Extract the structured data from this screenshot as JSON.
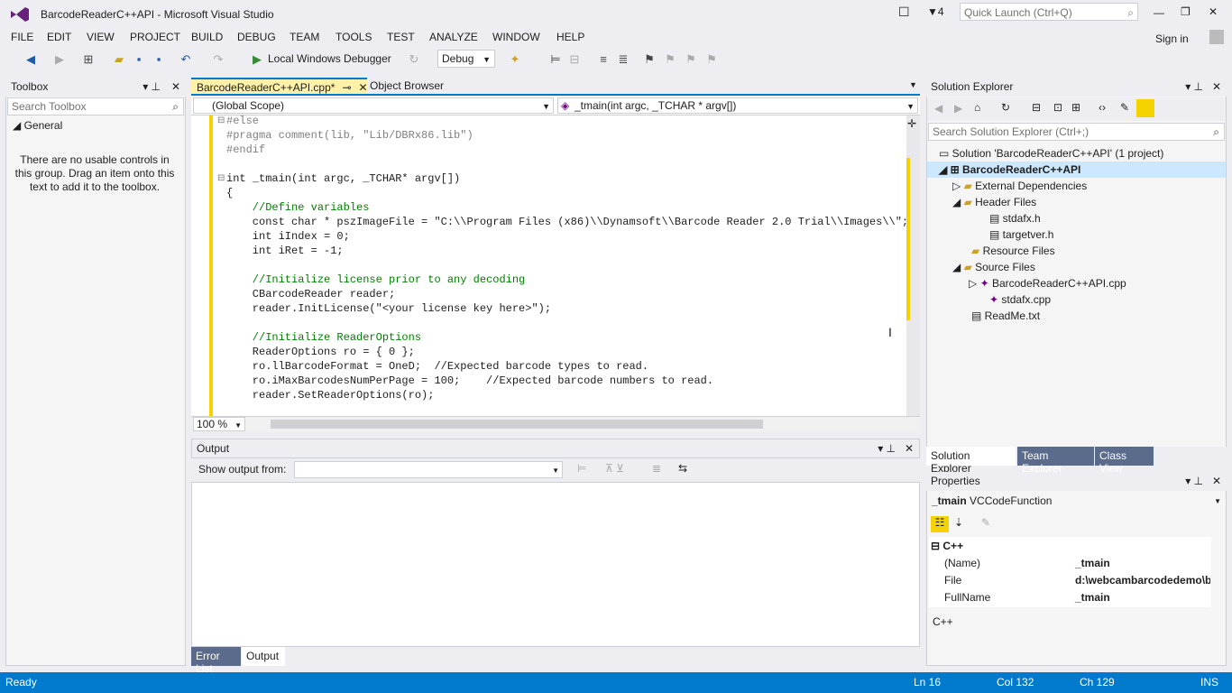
{
  "app": {
    "title": "BarcodeReaderC++API - Microsoft Visual Studio",
    "notifications": "4",
    "quick_launch_placeholder": "Quick Launch (Ctrl+Q)",
    "sign_in": "Sign in"
  },
  "menu": [
    "FILE",
    "EDIT",
    "VIEW",
    "PROJECT",
    "BUILD",
    "DEBUG",
    "TEAM",
    "TOOLS",
    "TEST",
    "ANALYZE",
    "WINDOW",
    "HELP"
  ],
  "toolbar": {
    "debugger": "Local Windows Debugger",
    "config": "Debug"
  },
  "toolbox": {
    "title": "Toolbox",
    "search_placeholder": "Search Toolbox",
    "group": "General",
    "message": "There are no usable controls in this group. Drag an item onto this text to add it to the toolbox."
  },
  "editor": {
    "tabs": [
      {
        "label": "BarcodeReaderC++API.cpp*"
      },
      {
        "label": "Object Browser"
      }
    ],
    "scope": "(Global Scope)",
    "function": "_tmain(int argc, _TCHAR * argv[])",
    "zoom": "100 %",
    "lines": [
      "#else",
      "#pragma comment(lib, \"Lib/DBRx86.lib\")",
      "#endif",
      "",
      "int _tmain(int argc, _TCHAR* argv[])",
      "{",
      "    //Define variables",
      "    const char * pszImageFile = \"C:\\\\Program Files (x86)\\\\Dynamsoft\\\\Barcode Reader 2.0 Trial\\\\Images\\\\\";",
      "    int iIndex = 0;",
      "    int iRet = -1;",
      "",
      "    //Initialize license prior to any decoding",
      "    CBarcodeReader reader;",
      "    reader.InitLicense(\"<your license key here>\");",
      "",
      "    //Initialize ReaderOptions",
      "    ReaderOptions ro = { 0 };",
      "    ro.llBarcodeFormat = OneD;  //Expected barcode types to read.",
      "    ro.iMaxBarcodesNumPerPage = 100;    //Expected barcode numbers to read.",
      "    reader.SetReaderOptions(ro);"
    ]
  },
  "output": {
    "title": "Output",
    "show_from": "Show output from:",
    "tabs": [
      "Error List",
      "Output"
    ]
  },
  "solution_explorer": {
    "title": "Solution Explorer",
    "search_placeholder": "Search Solution Explorer (Ctrl+;)",
    "items": [
      {
        "label": "Solution 'BarcodeReaderC++API' (1 project)"
      },
      {
        "label": "BarcodeReaderC++API"
      },
      {
        "label": "External Dependencies"
      },
      {
        "label": "Header Files"
      },
      {
        "label": "stdafx.h"
      },
      {
        "label": "targetver.h"
      },
      {
        "label": "Resource Files"
      },
      {
        "label": "Source Files"
      },
      {
        "label": "BarcodeReaderC++API.cpp"
      },
      {
        "label": "stdafx.cpp"
      },
      {
        "label": "ReadMe.txt"
      }
    ],
    "tabs": [
      "Solution Explorer",
      "Team Explorer",
      "Class View"
    ]
  },
  "properties": {
    "title": "Properties",
    "object": "_tmain",
    "object_type": "VCCodeFunction",
    "category": "C++",
    "rows": [
      {
        "name": "(Name)",
        "value": "_tmain"
      },
      {
        "name": "File",
        "value": "d:\\webcambarcodedemo\\b"
      },
      {
        "name": "FullName",
        "value": "_tmain"
      }
    ],
    "description": "C++"
  },
  "status": {
    "state": "Ready",
    "ln": "Ln 16",
    "col": "Col 132",
    "ch": "Ch 129",
    "mode": "INS"
  },
  "colors": {
    "accent": "#007acc",
    "active_tab": "#fff1a8",
    "change_bar": "#f5d300"
  }
}
